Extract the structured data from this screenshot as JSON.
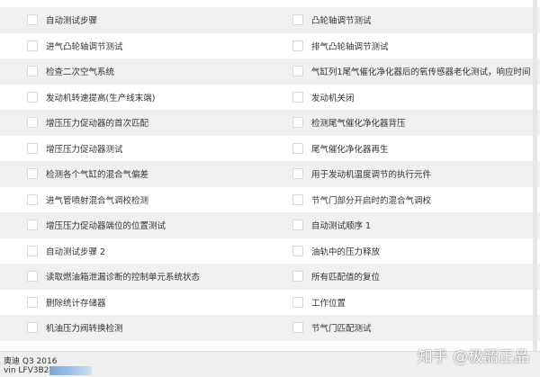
{
  "rows": [
    {
      "left": "自动测试步骤",
      "right": "凸轮轴调节测试"
    },
    {
      "left": "进气凸轮轴调节测试",
      "right": "排气凸轮轴调节测试"
    },
    {
      "left": "检查二次空气系统",
      "right": "气缸列1尾气催化净化器后的氧传感器老化测试，响应时间"
    },
    {
      "left": "发动机转速提高(生产线末端)",
      "right": "发动机关闭"
    },
    {
      "left": "增压压力促动器的首次匹配",
      "right": "检测尾气催化净化器背压"
    },
    {
      "left": "增压压力促动器测试",
      "right": "尾气催化净化器再生"
    },
    {
      "left": "检测各个气缸的混合气偏差",
      "right": "用于发动机温度调节的执行元件"
    },
    {
      "left": "进气管喷射混合气调校检测",
      "right": "节气门部分开启时的混合气调校"
    },
    {
      "left": "增压压力促动器端位的位置测试",
      "right": "自动测试顺序 1"
    },
    {
      "left": "自动测试步骤 2",
      "right": "油轨中的压力释放"
    },
    {
      "left": "读取燃油箱泄漏诊断的控制单元系统状态",
      "right": "所有匹配值的复位"
    },
    {
      "left": "删除统计存储器",
      "right": "工作位置"
    },
    {
      "left": "机油压力阀转换检测",
      "right": "节气门匹配测试"
    }
  ],
  "footer": {
    "car_model": "奥迪 Q3 2016",
    "vin_prefix": "vin LFV3B2"
  },
  "watermark": "知乎 @极韶正品"
}
